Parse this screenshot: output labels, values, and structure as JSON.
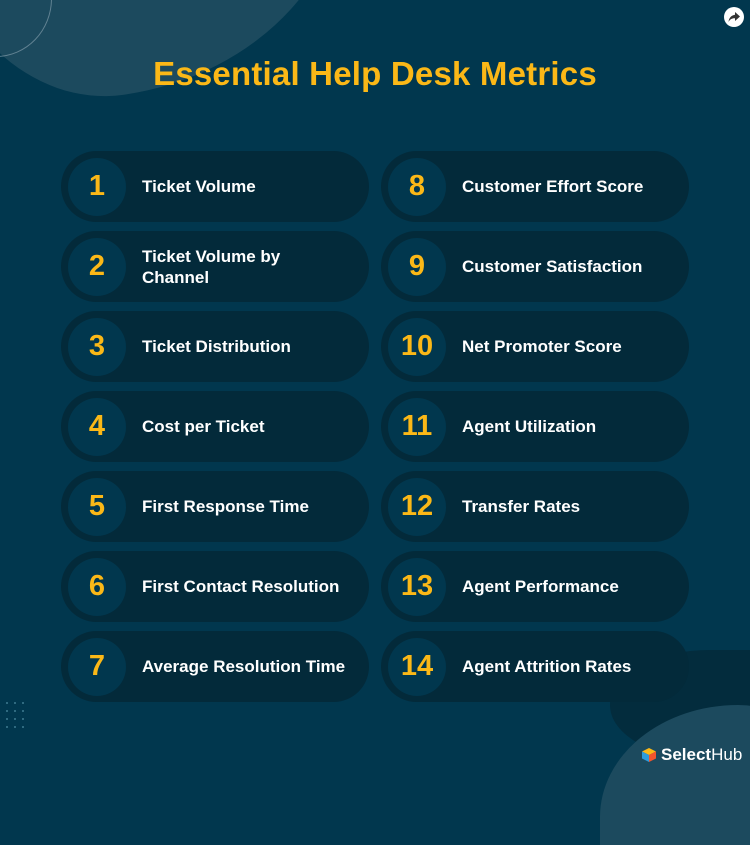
{
  "title": "Essential Help Desk Metrics",
  "colors": {
    "background": "#01374e",
    "pill": "#032a3a",
    "accent": "#fbb817",
    "text": "#ffffff"
  },
  "share": {
    "icon": "share-icon"
  },
  "metrics_left": [
    {
      "number": "1",
      "label": "Ticket Volume"
    },
    {
      "number": "2",
      "label": "Ticket Volume by Channel"
    },
    {
      "number": "3",
      "label": "Ticket Distribution"
    },
    {
      "number": "4",
      "label": "Cost per Ticket"
    },
    {
      "number": "5",
      "label": "First Response Time"
    },
    {
      "number": "6",
      "label": "First Contact Resolution"
    },
    {
      "number": "7",
      "label": "Average Resolution Time"
    }
  ],
  "metrics_right": [
    {
      "number": "8",
      "label": "Customer Effort Score"
    },
    {
      "number": "9",
      "label": "Customer Satisfaction"
    },
    {
      "number": "10",
      "label": "Net Promoter Score"
    },
    {
      "number": "11",
      "label": "Agent Utilization"
    },
    {
      "number": "12",
      "label": "Transfer Rates"
    },
    {
      "number": "13",
      "label": "Agent Performance"
    },
    {
      "number": "14",
      "label": "Agent Attrition Rates"
    }
  ],
  "brand": {
    "part1": "Select",
    "part2": "Hub",
    "icon": "selecthub-cube-icon"
  }
}
